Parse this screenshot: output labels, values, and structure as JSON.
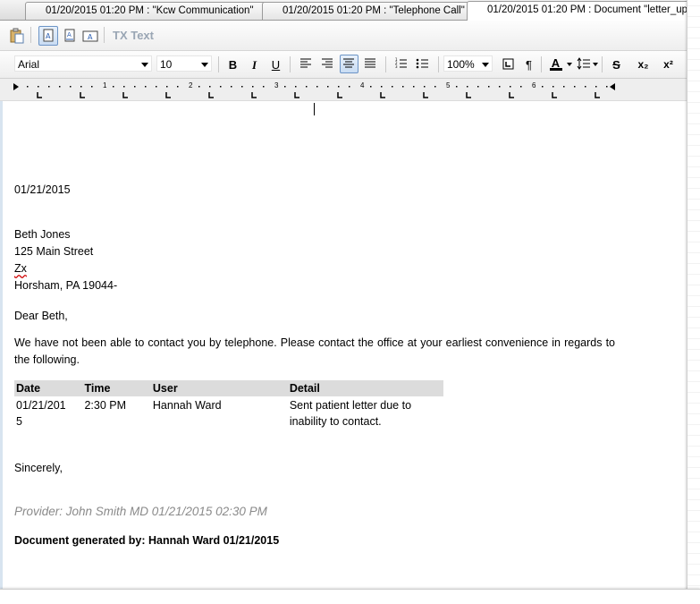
{
  "tabs": [
    {
      "label": "01/20/2015 01:20 PM : \"Kcw Communication\""
    },
    {
      "label": "01/20/2015 01:20 PM : \"Telephone Call\""
    },
    {
      "label": "01/20/2015 01:20 PM  : Document \"letter_up"
    }
  ],
  "toolbar": {
    "tx_text_label": "TX Text"
  },
  "format_toolbar": {
    "font_name": "Arial",
    "font_size": "10",
    "bold": "B",
    "italic": "I",
    "underline": "U",
    "zoom": "100%",
    "pilcrow": "¶",
    "font_color": "A",
    "strike": "S",
    "subscript": "x₂",
    "superscript": "x²"
  },
  "ruler": {
    "marks": [
      "1",
      "2",
      "3",
      "4",
      "5",
      "6"
    ]
  },
  "document": {
    "date": "01/21/2015",
    "address": [
      "Beth Jones",
      "125 Main Street",
      "Zx",
      "Horsham,  PA 19044-"
    ],
    "salutation": "Dear Beth,",
    "body": "We have not been able to contact you by telephone. Please contact the office at your earliest convenience in regards to the following.",
    "table": {
      "headers": [
        "Date",
        "Time",
        "User",
        "Detail"
      ],
      "rows": [
        [
          "01/21/201\n5",
          "2:30 PM",
          "Hannah Ward",
          "Sent patient letter due to inability to contact."
        ]
      ]
    },
    "closing": "Sincerely,",
    "provider": "Provider:  John Smith MD 01/21/2015 02:30 PM",
    "generated_by": "Document generated by:  Hannah Ward  01/21/2015"
  },
  "colors": {
    "accent": "#6c94c6",
    "provider_text": "#8a8a8a",
    "table_header": "#dcdcdc",
    "tx_text": "#9aa6b4"
  },
  "icons": [
    "paste-icon",
    "view-normal-icon",
    "view-web-icon",
    "view-print-icon",
    "align-left-icon",
    "align-right-icon",
    "align-center-icon",
    "align-justify-icon",
    "numbered-list-icon",
    "bullet-list-icon",
    "line-spacing-icon"
  ]
}
